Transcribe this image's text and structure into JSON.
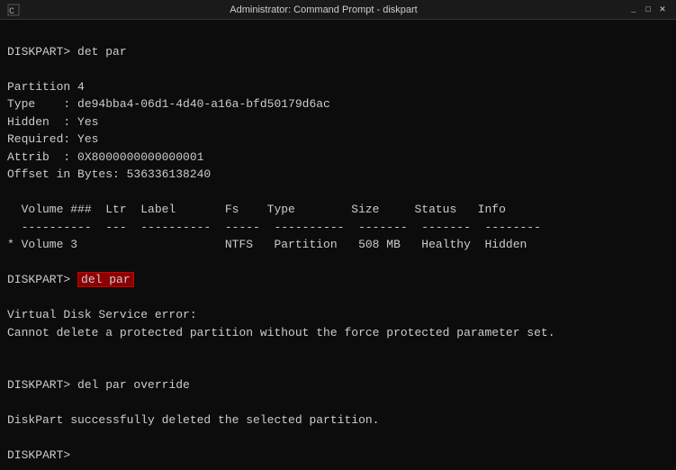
{
  "titleBar": {
    "icon": "▶",
    "text": "Administrator: Command Prompt - diskpart",
    "minimizeLabel": "_",
    "maximizeLabel": "□",
    "closeLabel": "✕"
  },
  "terminal": {
    "lines": [
      {
        "type": "prompt-command",
        "prompt": "DISKPART> ",
        "command": "det par",
        "highlight": false
      },
      {
        "type": "empty"
      },
      {
        "type": "text",
        "content": "Partition 4"
      },
      {
        "type": "text",
        "content": "Type    : de94bba4-06d1-4d40-a16a-bfd50179d6ac"
      },
      {
        "type": "text",
        "content": "Hidden  : Yes"
      },
      {
        "type": "text",
        "content": "Required: Yes"
      },
      {
        "type": "text",
        "content": "Attrib  : 0X8000000000000001"
      },
      {
        "type": "text",
        "content": "Offset in Bytes: 536336138240"
      },
      {
        "type": "empty"
      },
      {
        "type": "text",
        "content": "  Volume ###  Ltr  Label       Fs    Type        Size     Status   Info"
      },
      {
        "type": "text",
        "content": "  ----------  ---  ----------  -----  ----------  -------  -------  --------"
      },
      {
        "type": "text",
        "content": "* Volume 3                     NTFS   Partition   508 MB   Healthy  Hidden"
      },
      {
        "type": "empty"
      },
      {
        "type": "prompt-command",
        "prompt": "DISKPART> ",
        "command": "del par",
        "highlight": true
      },
      {
        "type": "empty"
      },
      {
        "type": "text",
        "content": "Virtual Disk Service error:"
      },
      {
        "type": "text",
        "content": "Cannot delete a protected partition without the force protected parameter set."
      },
      {
        "type": "empty"
      },
      {
        "type": "empty"
      },
      {
        "type": "prompt-command",
        "prompt": "DISKPART> ",
        "command": "del par override",
        "highlight": false
      },
      {
        "type": "empty"
      },
      {
        "type": "text",
        "content": "DiskPart successfully deleted the selected partition."
      },
      {
        "type": "empty"
      },
      {
        "type": "prompt-only",
        "prompt": "DISKPART> "
      }
    ]
  }
}
